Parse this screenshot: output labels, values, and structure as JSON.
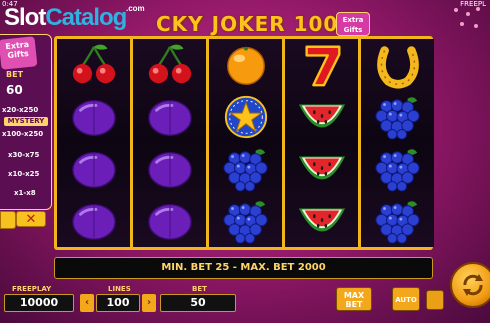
{
  "header": {
    "time": "0:47",
    "freeplay_label": "FREEPL",
    "watermark_slot": "Slot",
    "watermark_catalog": "Catalog",
    "watermark_com": ".com",
    "game_title": "CKY JOKER 100",
    "extra_gifts": "Extra Gifts"
  },
  "side_panel": {
    "badge": "Extra Gifts",
    "bet_label": "BET",
    "bet_value": "60",
    "multipliers": [
      "x20-x250",
      "MYSTERY",
      "x100-x250",
      "x30-x75",
      "x10-x25",
      "x1-x8"
    ],
    "close_label": "✕"
  },
  "reels": [
    [
      "cherry-icon",
      "plum-icon",
      "plum-icon",
      "plum-icon"
    ],
    [
      "cherry-icon",
      "plum-icon",
      "plum-icon",
      "plum-icon"
    ],
    [
      "orange-icon",
      "star-icon",
      "grapes-icon",
      "grapes-icon"
    ],
    [
      "seven-icon",
      "watermelon-icon",
      "watermelon-icon",
      "watermelon-icon"
    ],
    [
      "horseshoe-icon",
      "grapes-icon",
      "grapes-icon",
      "grapes-icon"
    ]
  ],
  "info_bar": "MIN. BET 25 - MAX. BET 2000",
  "controls": {
    "freeplay_label": "FREEPLAY",
    "freeplay_value": "10000",
    "lines_label": "LINES",
    "lines_value": "100",
    "bet_label": "BET",
    "bet_value": "50",
    "max_bet_label": "MAX BET",
    "auto_label": "AUTO"
  },
  "colors": {
    "background": "#8a1663",
    "reel_frame": "#f0b61c",
    "accent": "#ffd56a"
  }
}
